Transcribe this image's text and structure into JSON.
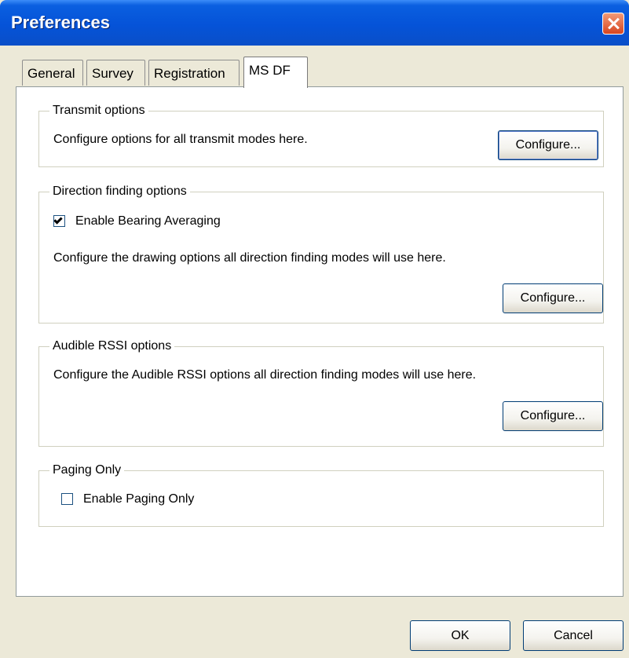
{
  "window": {
    "title": "Preferences"
  },
  "tabs": [
    {
      "label": "General",
      "active": false
    },
    {
      "label": "Survey",
      "active": false
    },
    {
      "label": "Registration",
      "active": false
    },
    {
      "label": "MS DF",
      "active": true
    }
  ],
  "transmit_options": {
    "legend": "Transmit options",
    "description": "Configure options for all transmit modes here.",
    "button": "Configure..."
  },
  "direction_finding_options": {
    "legend": "Direction finding options",
    "checkbox_label": "Enable Bearing Averaging",
    "checkbox_checked": true,
    "description": "Configure the drawing options all direction finding modes will use here.",
    "button": "Configure..."
  },
  "audible_rssi_options": {
    "legend": "Audible RSSI options",
    "description": "Configure the Audible RSSI options all direction finding modes will use here.",
    "button": "Configure..."
  },
  "paging_only": {
    "legend": "Paging Only",
    "checkbox_label": "Enable Paging Only",
    "checkbox_checked": false
  },
  "footer": {
    "ok": "OK",
    "cancel": "Cancel"
  },
  "colors": {
    "titlebar": "#0553D8",
    "dialog_bg": "#ECE9D8",
    "close_button": "#D8451F",
    "button_border": "#003C74"
  },
  "icons": {
    "close": "close-icon",
    "checkbox_checked": "checkmark-icon"
  }
}
